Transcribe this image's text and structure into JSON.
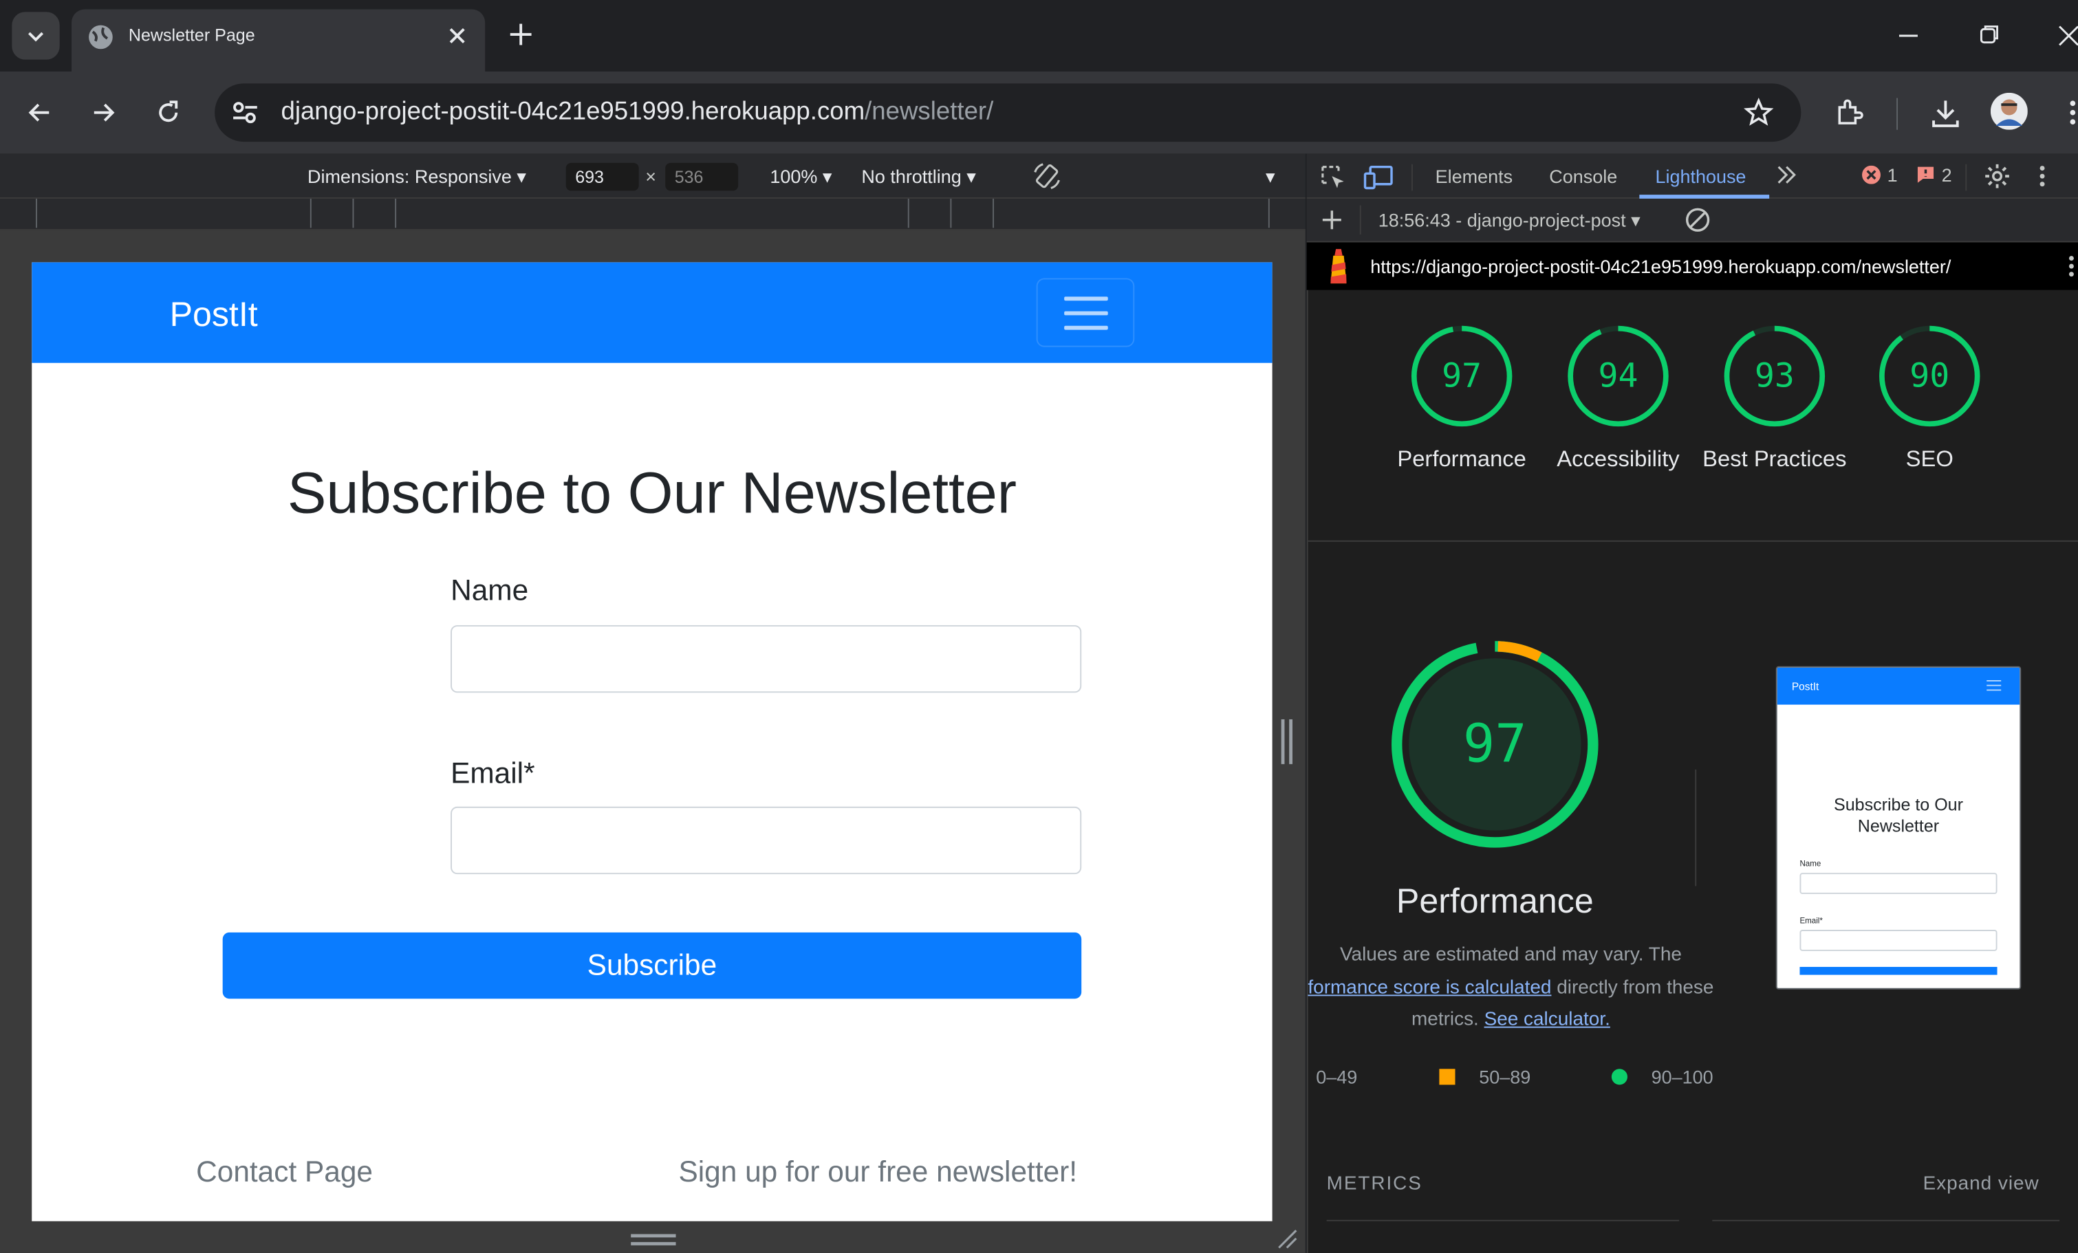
{
  "browser": {
    "tab_title": "Newsletter Page",
    "url_host": "django-project-postit-04c21e951999.herokuapp.com",
    "url_path": "/newsletter/"
  },
  "device_toolbar": {
    "dimensions_label": "Dimensions: Responsive",
    "width": "693",
    "height": "536",
    "times": "×",
    "zoom": "100%",
    "throttling": "No throttling"
  },
  "page": {
    "brand": "PostIt",
    "heading": "Subscribe to Our Newsletter",
    "name_label": "Name",
    "email_label": "Email*",
    "subscribe_button": "Subscribe",
    "footer_left": "Contact Page",
    "footer_right": "Sign up for our free newsletter!"
  },
  "devtools": {
    "tabs": [
      "Elements",
      "Console",
      "Lighthouse"
    ],
    "active_tab": "Lighthouse",
    "error_count": "1",
    "issue_count": "2",
    "report_selector": "18:56:43 - django-project-post",
    "report_url": "https://django-project-postit-04c21e951999.herokuapp.com/newsletter/"
  },
  "lighthouse": {
    "scores": [
      {
        "label": "Performance",
        "value": 97
      },
      {
        "label": "Accessibility",
        "value": 94
      },
      {
        "label": "Best Practices",
        "value": 93
      },
      {
        "label": "SEO",
        "value": 90
      }
    ],
    "main_score": "97",
    "main_title": "Performance",
    "note_pre": "Values are estimated and may vary. The",
    "note_link1": "formance score is calculated",
    "note_mid": "directly from these",
    "note_mid2": "metrics.",
    "note_link2": "See calculator.",
    "legend": [
      "0–49",
      "50–89",
      "90–100"
    ],
    "legend_colors": [
      "#ff4e42",
      "#ffa400",
      "#0cce6b"
    ],
    "metrics_header": "METRICS",
    "expand_view": "Expand view",
    "thumb_brand": "PostIt",
    "thumb_heading": "Subscribe to Our Newsletter",
    "thumb_name": "Name",
    "thumb_email": "Email*"
  }
}
